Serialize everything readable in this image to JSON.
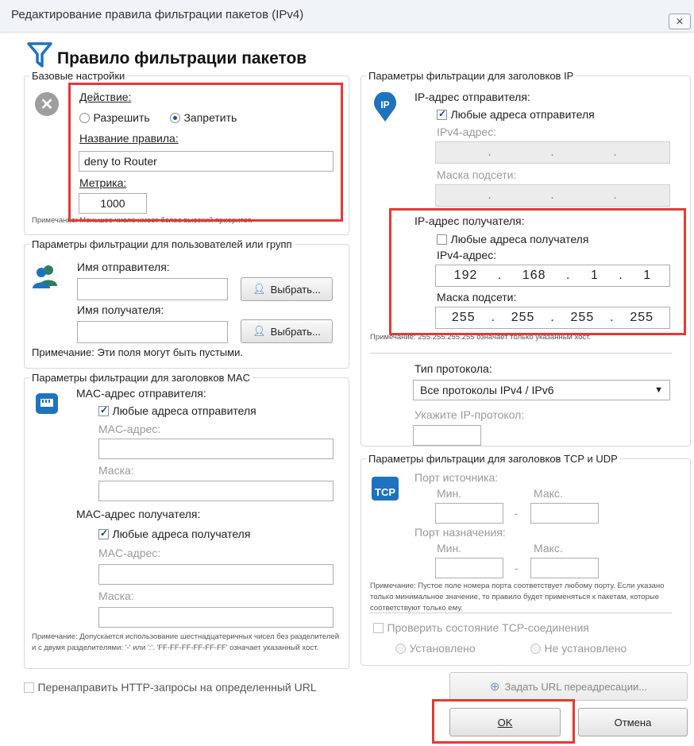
{
  "window": {
    "title": "Редактирование правила фильтрации пакетов (IPv4)",
    "close_glyph": "⨯"
  },
  "heading": "Правило фильтрации пакетов",
  "basic": {
    "legend": "Базовые настройки",
    "action_label": "Действие:",
    "allow_label": "Разрешить",
    "deny_label": "Запретить",
    "selected_action": "deny",
    "rule_name_label": "Название правила:",
    "rule_name_value": "deny to Router",
    "metric_label": "Метрика:",
    "metric_value": "1000",
    "note": "Примечание: Меньшее число имеет более высокий приоритет."
  },
  "users": {
    "legend": "Параметры фильтрации для пользователей или групп",
    "sender_label": "Имя отправителя:",
    "sender_value": "",
    "receiver_label": "Имя получателя:",
    "receiver_value": "",
    "select_button": "Выбрать...",
    "note": "Примечание: Эти поля могут быть пустыми."
  },
  "mac": {
    "legend": "Параметры фильтрации для заголовков MAC",
    "src_label": "MAC-адрес отправителя:",
    "src_any_label": "Любые адреса отправителя",
    "src_any_checked": true,
    "mac_address_label": "MAC-адрес:",
    "mask_label": "Маска:",
    "dst_label": "MAC-адрес получателя:",
    "dst_any_label": "Любые адреса получателя",
    "dst_any_checked": true,
    "note": "Примечание: Допускается использование шестнадцатеричных чисел без разделителей и с двумя разделителями: '-' или ':'. 'FF-FF-FF-FF-FF-FF' означает указанный хост."
  },
  "ip": {
    "legend": "Параметры фильтрации для заголовков IP",
    "src_label": "IP-адрес отправителя:",
    "src_any_label": "Любые адреса отправителя",
    "src_any_checked": true,
    "ipv4_label": "IPv4-адрес:",
    "mask_label": "Маска подсети:",
    "dst_label": "IP-адрес получателя:",
    "dst_any_label": "Любые адреса получателя",
    "dst_any_checked": false,
    "dst_ipv4_label": "IPv4-адрес:",
    "dst_mask_label": "Маска подсети:",
    "dst_ip": [
      "192",
      "168",
      "1",
      "1"
    ],
    "dst_mask": [
      "255",
      "255",
      "255",
      "255"
    ],
    "note": "Примечание: 255.255.255.255 означает только указанный хост.",
    "protocol_label": "Тип протокола:",
    "protocol_value": "Все протоколы IPv4 / IPv6",
    "ip_protocol_label": "Укажите IP-протокол:"
  },
  "tcp": {
    "legend": "Параметры фильтрации для заголовков TCP и UDP",
    "icon_text": "TCP",
    "src_port_label": "Порт источника:",
    "dst_port_label": "Порт назначения:",
    "min_label": "Мин.",
    "max_label": "Макс.",
    "dash": "-",
    "note": "Примечание: Пустое поле номера порта соответствует любому порту. Если указано только минимальное значение, то правило будет применяться к пакетам, которые соответствуют только ему.",
    "check_state_label": "Проверить состояние TCP-соединения",
    "established_label": "Установлено",
    "not_established_label": "Не установлено"
  },
  "bottom": {
    "redirect_label": "Перенаправить HTTP-запросы на определенный URL",
    "set_url_button": "Задать URL переадресации...",
    "ok_button": "OK",
    "cancel_button": "Отмена"
  },
  "colors": {
    "highlight": "#e53935",
    "icon_blue": "#1e73be",
    "icon_gray": "#8c8c8c"
  }
}
